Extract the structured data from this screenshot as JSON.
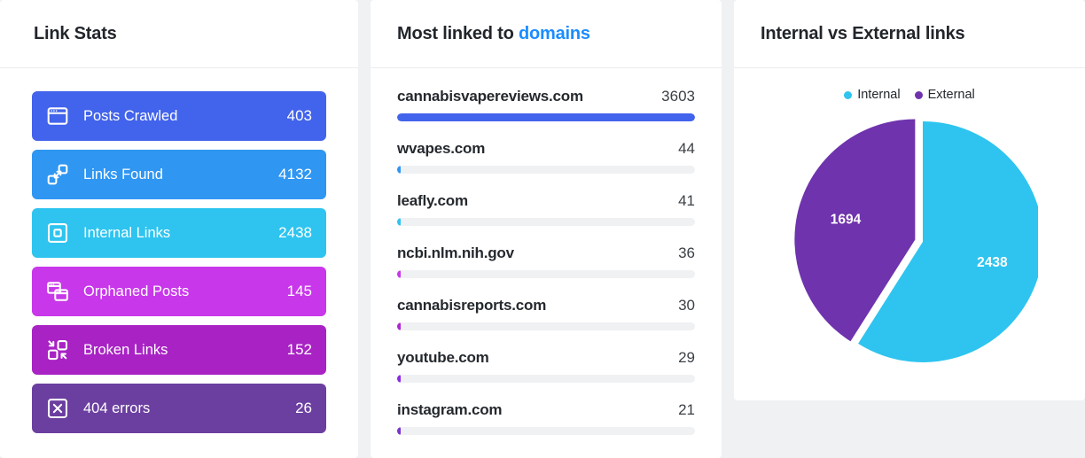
{
  "theme": {
    "page_bg": "#eff1f3",
    "card_bg": "#ffffff",
    "accent_link": "#1a8cff",
    "track": "#f0f1f3"
  },
  "stats_panel": {
    "title": "Link Stats",
    "items": [
      {
        "label": "Posts Crawled",
        "value": "403",
        "color": "#4263eb",
        "icon": "browser-window-icon"
      },
      {
        "label": "Links Found",
        "value": "4132",
        "color": "#2f96f2",
        "icon": "linked-squares-icon"
      },
      {
        "label": "Internal Links",
        "value": "2438",
        "color": "#2ec4ef",
        "icon": "square-in-square-icon"
      },
      {
        "label": "Orphaned Posts",
        "value": "145",
        "color": "#c837ea",
        "icon": "stacked-windows-icon"
      },
      {
        "label": "Broken Links",
        "value": "152",
        "color": "#a822c4",
        "icon": "broken-squares-icon"
      },
      {
        "label": "404 errors",
        "value": "26",
        "color": "#6b3fa0",
        "icon": "x-square-icon"
      }
    ]
  },
  "domains_panel": {
    "title_prefix": "Most linked to ",
    "title_accent": "domains",
    "max_value": 3603,
    "rows": [
      {
        "domain": "cannabisvapereviews.com",
        "count": "3603",
        "value": 3603,
        "color": "#4263eb"
      },
      {
        "domain": "wvapes.com",
        "count": "44",
        "value": 44,
        "color": "#2f96f2"
      },
      {
        "domain": "leafly.com",
        "count": "41",
        "value": 41,
        "color": "#2ec4ef"
      },
      {
        "domain": "ncbi.nlm.nih.gov",
        "count": "36",
        "value": 36,
        "color": "#c837ea"
      },
      {
        "domain": "cannabisreports.com",
        "count": "30",
        "value": 30,
        "color": "#b026d3"
      },
      {
        "domain": "youtube.com",
        "count": "29",
        "value": 29,
        "color": "#8a2be2"
      },
      {
        "domain": "instagram.com",
        "count": "21",
        "value": 21,
        "color": "#7a35c9"
      }
    ]
  },
  "pie_panel": {
    "title": "Internal vs External links"
  },
  "chart_data": {
    "type": "pie",
    "title": "Internal vs External links",
    "legend_position": "top",
    "labels": [
      "Internal",
      "External"
    ],
    "values": [
      2438,
      1694
    ],
    "colors": [
      "#2ec4ef",
      "#6f33ad"
    ],
    "data_labels": [
      "2438",
      "1694"
    ],
    "total": 4132,
    "percentages": [
      59.0,
      41.0
    ],
    "exploded_slice": "External",
    "start_angle_deg": 0
  }
}
